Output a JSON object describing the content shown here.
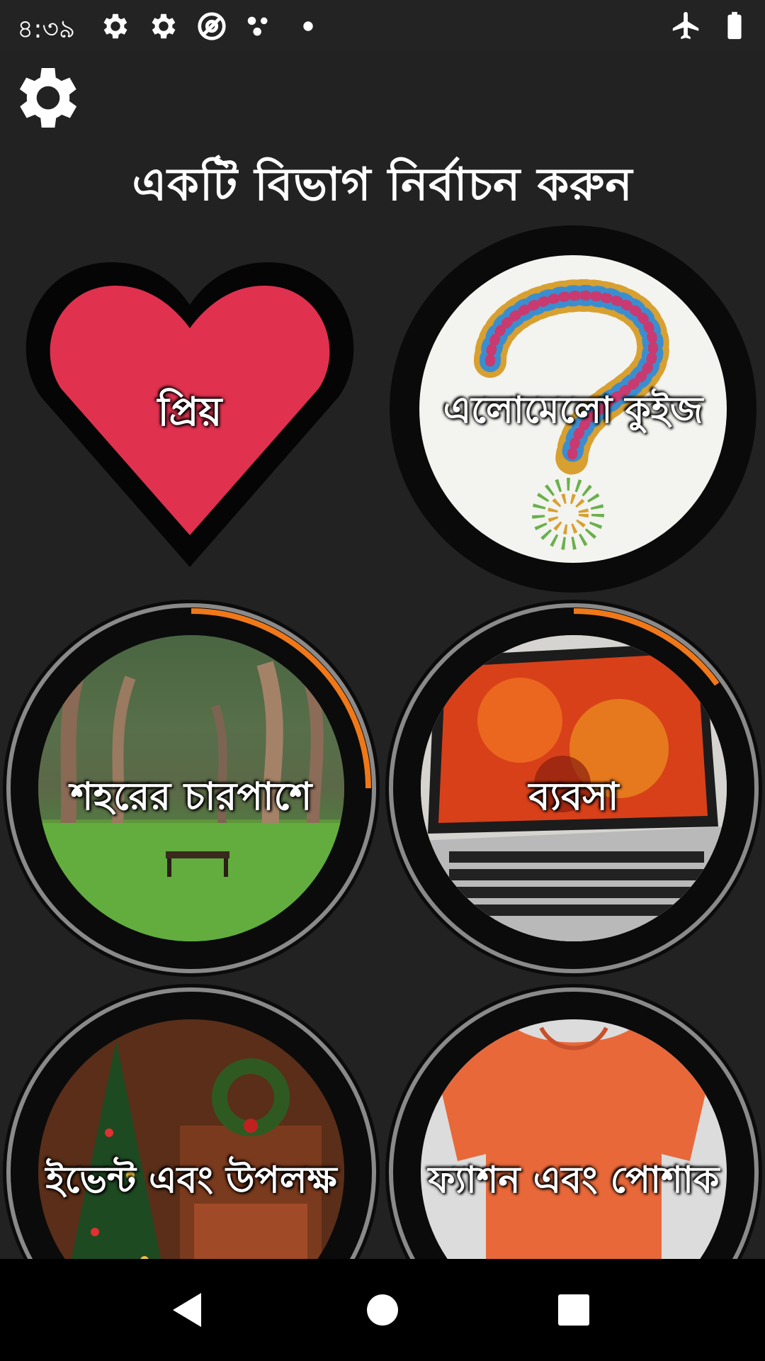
{
  "status_bar": {
    "time": "৪:৩৯",
    "left_icons": [
      "gear-icon",
      "gear-icon",
      "at-sign-icon",
      "dots-icon",
      "dot-icon"
    ],
    "right_icons": [
      "airplane-mode-icon",
      "battery-icon"
    ]
  },
  "header": {
    "title": "একটি বিভাগ নির্বাচন করুন",
    "settings_icon": "gear-icon"
  },
  "categories": [
    {
      "label": "প্রিয়",
      "style": "heart",
      "color": "#e0314f"
    },
    {
      "label": "এলোমেলো কুইজ",
      "style": "question-mark-circle"
    },
    {
      "label": "শহরের চারপাশে",
      "style": "park-photo",
      "progress": 0.25
    },
    {
      "label": "ব্যবসা",
      "style": "laptop-photo",
      "progress": 0.15
    },
    {
      "label": "ইভেন্ট এবং উপলক্ষ",
      "style": "christmas-photo"
    },
    {
      "label": "ফ্যাশন এবং পোশাক",
      "style": "tshirt-photo"
    }
  ],
  "colors": {
    "background": "#222222",
    "accent": "#f07818",
    "heart": "#e0314f"
  },
  "nav_bar": {
    "back_icon": "back-triangle-icon",
    "home_icon": "home-circle-icon",
    "recents_icon": "recents-square-icon"
  }
}
